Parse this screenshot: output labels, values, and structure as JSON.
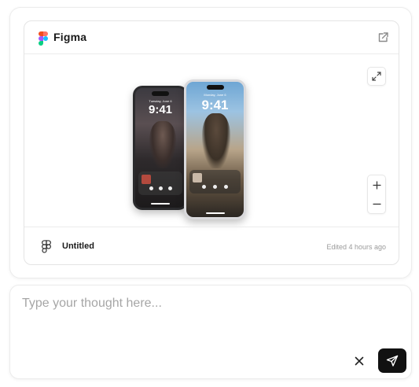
{
  "embed": {
    "brand": "Figma",
    "file_name": "Untitled",
    "edited": "Edited 4 hours ago",
    "icons": [
      "figma-logo",
      "external-link-icon",
      "expand-icon",
      "zoom-in-icon",
      "zoom-out-icon",
      "figma-file-icon"
    ]
  },
  "preview": {
    "phone_back": {
      "date": "Tuesday, June 6",
      "time": "9:41"
    },
    "phone_front": {
      "date": "Monday, June 6",
      "time": "9:41"
    }
  },
  "composer": {
    "placeholder": "Type your thought here...",
    "icons": [
      "close-icon",
      "send-icon"
    ]
  },
  "colors": {
    "send_button": "#111111",
    "figma_red": "#F24E1E",
    "figma_orange": "#FF7262",
    "figma_purple": "#A259FF",
    "figma_blue": "#1ABCFE",
    "figma_green": "#0ACF83"
  }
}
